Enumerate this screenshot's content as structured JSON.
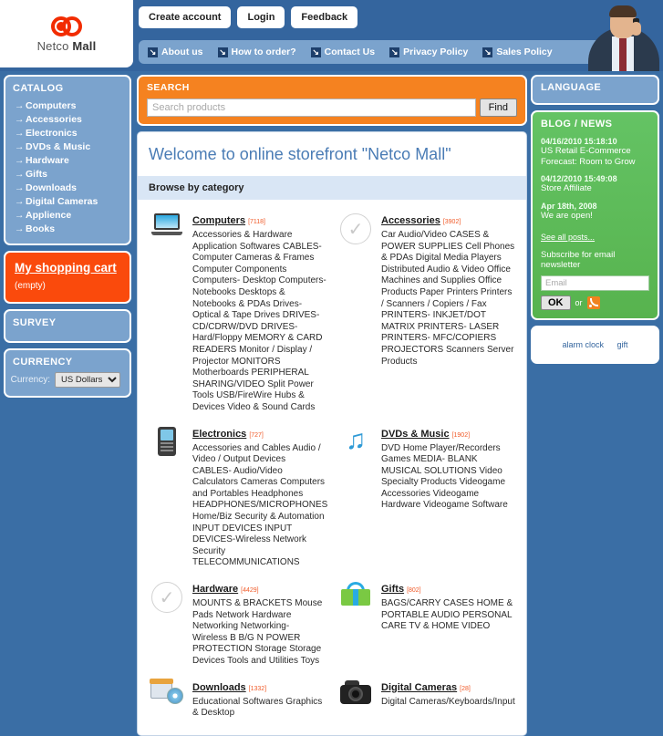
{
  "logo": {
    "name_light": "Netco",
    "name_bold": "Mall"
  },
  "header": {
    "buttons": [
      {
        "label": "Create account",
        "name": "create-account-button"
      },
      {
        "label": "Login",
        "name": "login-button"
      },
      {
        "label": "Feedback",
        "name": "feedback-button"
      }
    ],
    "nav": [
      {
        "label": "About us",
        "icon": "arrow-down-right-icon"
      },
      {
        "label": "How to order?",
        "icon": "arrow-down-right-icon"
      },
      {
        "label": "Contact Us",
        "icon": "arrow-down-right-icon"
      },
      {
        "label": "Privacy Policy",
        "icon": "arrow-down-right-icon"
      },
      {
        "label": "Sales Policy",
        "icon": "arrow-down-right-icon"
      }
    ]
  },
  "sidebar": {
    "catalog": {
      "title": "CATALOG",
      "items": [
        "Computers",
        "Accessories",
        "Electronics",
        "DVDs & Music",
        "Hardware",
        "Gifts",
        "Downloads",
        "Digital Cameras",
        "Applience",
        "Books"
      ]
    },
    "cart": {
      "title": "My shopping cart",
      "status": "(empty)"
    },
    "survey": {
      "title": "SURVEY"
    },
    "currency": {
      "title": "CURRENCY",
      "label": "Currency:",
      "selected": "US Dollars",
      "options": [
        "US Dollars"
      ]
    }
  },
  "search": {
    "title": "SEARCH",
    "placeholder": "Search products",
    "button": "Find",
    "value": ""
  },
  "main": {
    "welcome": "Welcome to online storefront \"Netco Mall\"",
    "browse_title": "Browse by category",
    "categories": [
      {
        "name": "Computers",
        "count": "[7118]",
        "icon": "laptop-icon",
        "desc": "Accessories & Hardware Application Softwares CABLES- Computer Cameras & Frames Computer Components Computers- Desktop Computers- Notebooks Desktops & Notebooks & PDAs Drives- Optical & Tape Drives DRIVES-CD/CDRW/DVD DRIVES-Hard/Floppy MEMORY & CARD READERS Monitor / Display / Projector MONITORS Motherboards PERIPHERAL SHARING/VIDEO Split Power Tools USB/FireWire Hubs & Devices Video & Sound Cards"
      },
      {
        "name": "Accessories",
        "count": "[3902]",
        "icon": "check-circle-icon",
        "desc": "Car Audio/Video CASES & POWER SUPPLIES Cell Phones & PDAs Digital Media Players Distributed Audio & Video Office Machines and Supplies Office Products Paper Printers Printers / Scanners / Copiers / Fax PRINTERS- INKJET/DOT MATRIX PRINTERS- LASER PRINTERS- MFC/COPIERS PROJECTORS Scanners Server Products"
      },
      {
        "name": "Electronics",
        "count": "[727]",
        "icon": "mobile-phone-icon",
        "desc": "Accessories and Cables Audio / Video / Output Devices CABLES- Audio/Video Calculators Cameras Computers and Portables Headphones HEADPHONES/MICROPHONES Home/Biz Security & Automation INPUT DEVICES INPUT DEVICES-Wireless Network Security TELECOMMUNICATIONS"
      },
      {
        "name": "DVDs & Music",
        "count": "[1902]",
        "icon": "music-note-icon",
        "desc": "DVD Home Player/Recorders Games MEDIA- BLANK MUSICAL SOLUTIONS Video Specialty Products Videogame Accessories Videogame Hardware Videogame Software"
      },
      {
        "name": "Hardware",
        "count": "[4429]",
        "icon": "check-circle-icon",
        "desc": "MOUNTS & BRACKETS Mouse Pads Network Hardware Networking Networking- Wireless B B/G N POWER PROTECTION Storage Storage Devices Tools and Utilities Toys"
      },
      {
        "name": "Gifts",
        "count": "[802]",
        "icon": "gift-icon",
        "desc": "BAGS/CARRY CASES HOME & PORTABLE AUDIO PERSONAL CARE TV & HOME VIDEO"
      },
      {
        "name": "Downloads",
        "count": "[1332]",
        "icon": "software-cd-icon",
        "desc": "Educational Softwares Graphics & Desktop"
      },
      {
        "name": "Digital Cameras",
        "count": "[28]",
        "icon": "camera-icon",
        "desc": "Digital Cameras/Keyboards/Input"
      }
    ]
  },
  "rightbar": {
    "language": {
      "title": "LANGUAGE"
    },
    "blog": {
      "title": "BLOG / NEWS",
      "posts": [
        {
          "date": "04/16/2010 15:18:10",
          "text": "US Retail E-Commerce Forecast: Room to Grow"
        },
        {
          "date": "04/12/2010 15:49:08",
          "text": "Store Affiliate"
        },
        {
          "date": "Apr 18th, 2008",
          "text": "We are open!"
        }
      ],
      "see_all": "See all posts...",
      "subscribe_title": "Subscribe for email newsletter",
      "email_placeholder": "Email",
      "email_value": "",
      "ok_label": "OK",
      "or_label": "or",
      "rss_icon": "rss-icon"
    },
    "tags": [
      "alarm clock",
      "gift"
    ]
  }
}
